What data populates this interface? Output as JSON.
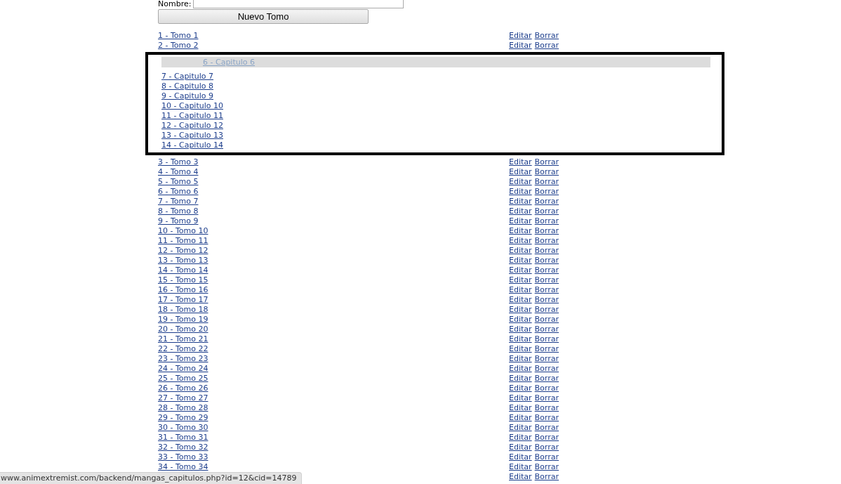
{
  "form": {
    "label": "Nombre:",
    "button": "Nuevo Tomo"
  },
  "tomos": [
    {
      "title": "1 - Tomo 1",
      "actions": [
        "Editar",
        "Borrar"
      ]
    },
    {
      "title": "2 - Tomo 2",
      "actions": [
        "Editar",
        "Borrar"
      ],
      "chapters": [
        {
          "title": "6 - Capitulo 6",
          "dragging": true
        },
        {
          "title": "7 - Capitulo 7",
          "dragging": false
        },
        {
          "title": "8 - Capitulo 8",
          "dragging": false
        },
        {
          "title": "9 - Capitulo 9",
          "dragging": false
        },
        {
          "title": "10 - Capitulo 10",
          "dragging": false
        },
        {
          "title": "11 - Capitulo 11",
          "dragging": false
        },
        {
          "title": "12 - Capitulo 12",
          "dragging": false
        },
        {
          "title": "13 - Capitulo 13",
          "dragging": false
        },
        {
          "title": "14 - Capitulo 14",
          "dragging": false
        }
      ]
    },
    {
      "title": "3 - Tomo 3",
      "actions": [
        "Editar",
        "Borrar"
      ]
    },
    {
      "title": "4 - Tomo 4",
      "actions": [
        "Editar",
        "Borrar"
      ]
    },
    {
      "title": "5 - Tomo 5",
      "actions": [
        "Editar",
        "Borrar"
      ]
    },
    {
      "title": "6 - Tomo 6",
      "actions": [
        "Editar",
        "Borrar"
      ]
    },
    {
      "title": "7 - Tomo 7",
      "actions": [
        "Editar",
        "Borrar"
      ]
    },
    {
      "title": "8 - Tomo 8",
      "actions": [
        "Editar",
        "Borrar"
      ]
    },
    {
      "title": "9 - Tomo 9",
      "actions": [
        "Editar",
        "Borrar"
      ]
    },
    {
      "title": "10 - Tomo 10",
      "actions": [
        "Editar",
        "Borrar"
      ]
    },
    {
      "title": "11 - Tomo 11",
      "actions": [
        "Editar",
        "Borrar"
      ]
    },
    {
      "title": "12 - Tomo 12",
      "actions": [
        "Editar",
        "Borrar"
      ]
    },
    {
      "title": "13 - Tomo 13",
      "actions": [
        "Editar",
        "Borrar"
      ]
    },
    {
      "title": "14 - Tomo 14",
      "actions": [
        "Editar",
        "Borrar"
      ]
    },
    {
      "title": "15 - Tomo 15",
      "actions": [
        "Editar",
        "Borrar"
      ]
    },
    {
      "title": "16 - Tomo 16",
      "actions": [
        "Editar",
        "Borrar"
      ]
    },
    {
      "title": "17 - Tomo 17",
      "actions": [
        "Editar",
        "Borrar"
      ]
    },
    {
      "title": "18 - Tomo 18",
      "actions": [
        "Editar",
        "Borrar"
      ]
    },
    {
      "title": "19 - Tomo 19",
      "actions": [
        "Editar",
        "Borrar"
      ]
    },
    {
      "title": "20 - Tomo 20",
      "actions": [
        "Editar",
        "Borrar"
      ]
    },
    {
      "title": "21 - Tomo 21",
      "actions": [
        "Editar",
        "Borrar"
      ]
    },
    {
      "title": "22 - Tomo 22",
      "actions": [
        "Editar",
        "Borrar"
      ]
    },
    {
      "title": "23 - Tomo 23",
      "actions": [
        "Editar",
        "Borrar"
      ]
    },
    {
      "title": "24 - Tomo 24",
      "actions": [
        "Editar",
        "Borrar"
      ]
    },
    {
      "title": "25 - Tomo 25",
      "actions": [
        "Editar",
        "Borrar"
      ]
    },
    {
      "title": "26 - Tomo 26",
      "actions": [
        "Editar",
        "Borrar"
      ]
    },
    {
      "title": "27 - Tomo 27",
      "actions": [
        "Editar",
        "Borrar"
      ]
    },
    {
      "title": "28 - Tomo 28",
      "actions": [
        "Editar",
        "Borrar"
      ]
    },
    {
      "title": "29 - Tomo 29",
      "actions": [
        "Editar",
        "Borrar"
      ]
    },
    {
      "title": "30 - Tomo 30",
      "actions": [
        "Editar",
        "Borrar"
      ]
    },
    {
      "title": "31 - Tomo 31",
      "actions": [
        "Editar",
        "Borrar"
      ]
    },
    {
      "title": "32 - Tomo 32",
      "actions": [
        "Editar",
        "Borrar"
      ]
    },
    {
      "title": "33 - Tomo 33",
      "actions": [
        "Editar",
        "Borrar"
      ]
    },
    {
      "title": "34 - Tomo 34",
      "actions": [
        "Editar",
        "Borrar"
      ]
    },
    {
      "actions": [
        "Editar",
        "Borrar"
      ]
    }
  ],
  "status_bar": {
    "url": "www.animextremist.com/backend/mangas_capitulos.php?id=12&cid=14789"
  }
}
